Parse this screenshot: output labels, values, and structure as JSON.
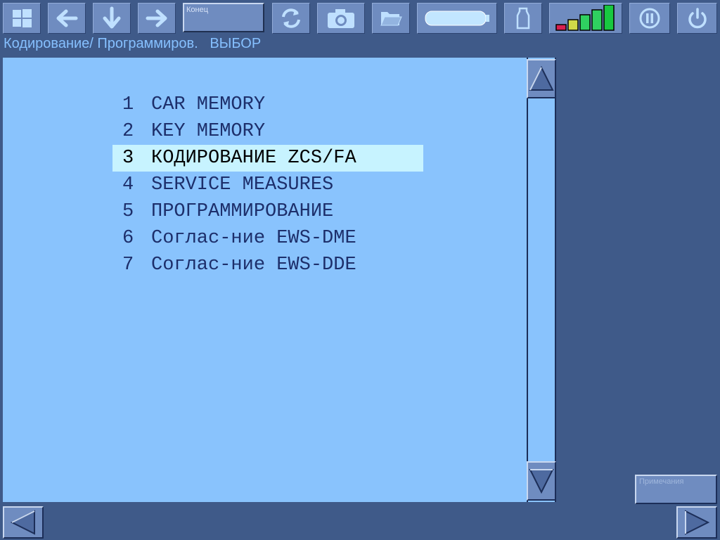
{
  "toolbar": {
    "icons": [
      "windows-icon",
      "arrow-left-icon",
      "arrow-down-icon",
      "arrow-right-icon",
      "refresh-icon",
      "camera-icon",
      "folder-icon",
      "battery-icon",
      "connector-icon",
      "signal-icon",
      "pause-icon",
      "power-icon"
    ],
    "end_label": "Конец",
    "signal_level": 5,
    "signal_colors": [
      "#d82050",
      "#d0d848",
      "#2fd060",
      "#2fd060",
      "#18c840"
    ]
  },
  "breadcrumb": "Кодирование/ Программиров.   ВЫБОР",
  "menu": {
    "selected_index": 2,
    "items": [
      {
        "num": "1",
        "label": "CAR MEMORY"
      },
      {
        "num": "2",
        "label": "KEY MEMORY"
      },
      {
        "num": "3",
        "label": "КОДИРОВАНИЕ ZCS/FA"
      },
      {
        "num": "4",
        "label": "SERVICE MEASURES"
      },
      {
        "num": "5",
        "label": "ПРОГРАММИРОВАНИЕ"
      },
      {
        "num": "6",
        "label": "Соглас-ние EWS-DME"
      },
      {
        "num": "7",
        "label": "Соглас-ние EWS-DDE"
      }
    ]
  },
  "notes_label": "Примечания",
  "colors": {
    "background": "#3f5a89",
    "panel": "#89c3fd",
    "button": "#6f8cc0",
    "selection": "#c7f3ff",
    "text": "#1d2f6b"
  }
}
